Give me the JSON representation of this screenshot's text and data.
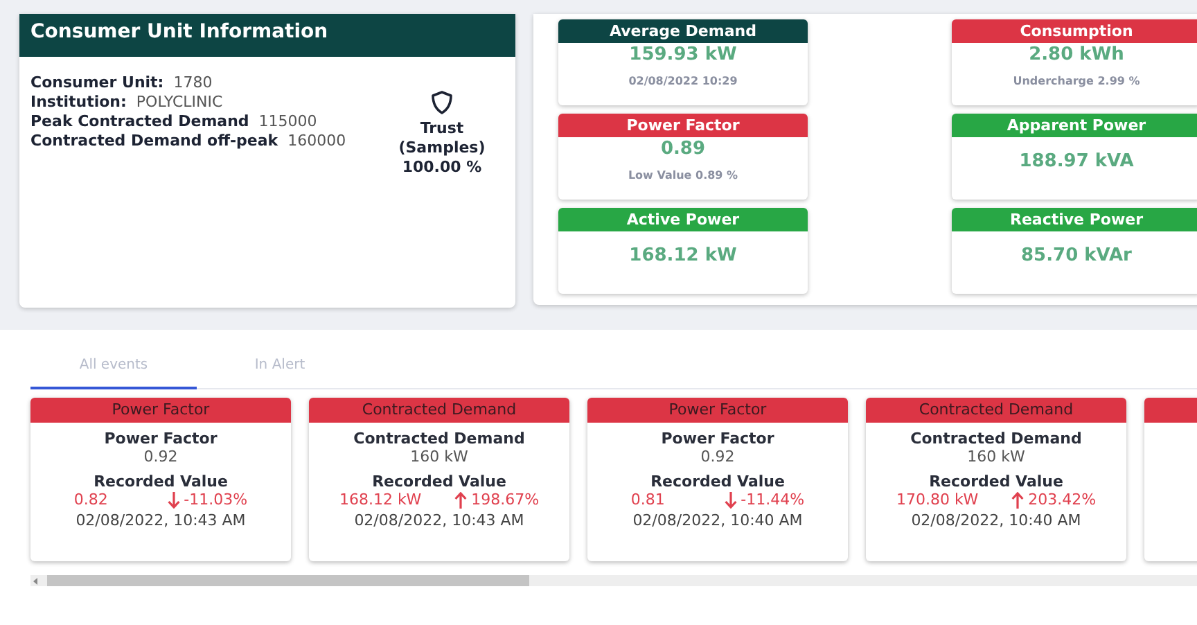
{
  "consumer_unit": {
    "title": "Consumer Unit Information",
    "fields": [
      {
        "label": "Consumer Unit:",
        "value": "1780"
      },
      {
        "label": "Institution:",
        "value": "POLYCLINIC"
      },
      {
        "label": "Peak Contracted Demand",
        "value": "115000"
      },
      {
        "label": "Contracted Demand off-peak",
        "value": "160000"
      }
    ],
    "trust": {
      "label": "Trust (Samples)",
      "value": "100.00 %"
    }
  },
  "metric_columns": [
    [
      {
        "title": "Average Demand",
        "color": "#0d4544",
        "value": "159.93 kW",
        "note": "02/08/2022 10:29"
      },
      {
        "title": "Power Factor",
        "color": "#dc3545",
        "value": "0.89",
        "note": "Low Value 0.89 %"
      },
      {
        "title": "Active Power",
        "color": "#28a745",
        "value": "168.12 kW"
      }
    ],
    [
      {
        "title": "Consumption",
        "color": "#dc3545",
        "value": "2.80 kWh",
        "note": "Undercharge 2.99 %"
      },
      {
        "title": "Apparent Power",
        "color": "#28a745",
        "value": "188.97 kVA"
      },
      {
        "title": "Reactive Power",
        "color": "#28a745",
        "value": "85.70 kVAr"
      }
    ]
  ],
  "tabs": [
    {
      "label": "All events",
      "selected": true
    },
    {
      "label": "In Alert",
      "selected": false
    }
  ],
  "events": [
    {
      "header": "Power Factor",
      "name": "Power Factor",
      "limit": "0.92",
      "recorded_label": "Recorded Value",
      "recorded": "0.82",
      "kind": "down",
      "change": "-11.03%",
      "time": "02/08/2022, 10:43 AM"
    },
    {
      "header": "Contracted Demand",
      "name": "Contracted Demand",
      "limit": "160 kW",
      "recorded_label": "Recorded Value",
      "recorded": "168.12 kW",
      "kind": "up",
      "change": "198.67%",
      "time": "02/08/2022, 10:43 AM"
    },
    {
      "header": "Power Factor",
      "name": "Power Factor",
      "limit": "0.92",
      "recorded_label": "Recorded Value",
      "recorded": "0.81",
      "kind": "down",
      "change": "-11.44%",
      "time": "02/08/2022, 10:40 AM"
    },
    {
      "header": "Contracted Demand",
      "name": "Contracted Demand",
      "limit": "160 kW",
      "recorded_label": "Recorded Value",
      "recorded": "170.80 kW",
      "kind": "up",
      "change": "203.42%",
      "time": "02/08/2022, 10:40 AM"
    }
  ]
}
